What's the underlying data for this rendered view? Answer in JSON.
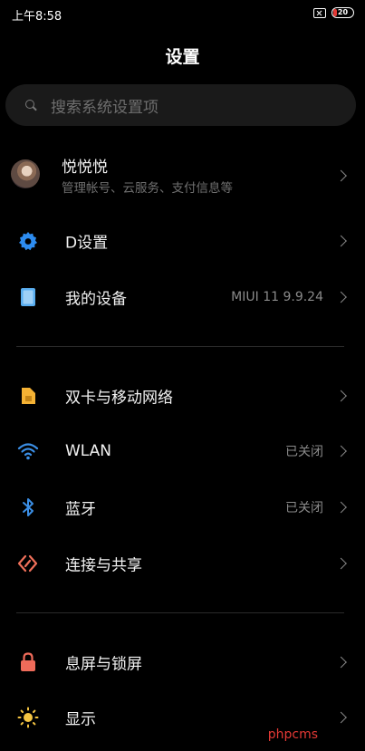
{
  "status_bar": {
    "time": "上午8:58",
    "battery": "20",
    "battery_level_percent": 20,
    "battery_color": "#e53935"
  },
  "page_title": "设置",
  "search": {
    "placeholder": "搜索系统设置项"
  },
  "account": {
    "name": "悦悦悦",
    "subtitle": "管理帐号、云服务、支付信息等"
  },
  "rows": [
    {
      "label": "D设置",
      "value": "",
      "icon": "gear-icon",
      "icon_color": "#2d8cf0"
    },
    {
      "label": "我的设备",
      "value": "MIUI 11 9.9.24",
      "icon": "phone-icon",
      "icon_color": "#5aaef0"
    },
    {
      "label": "双卡与移动网络",
      "value": "",
      "icon": "sim-card-icon",
      "icon_color": "#f5b234"
    },
    {
      "label": "WLAN",
      "value": "已关闭",
      "icon": "wifi-icon",
      "icon_color": "#3b8fe6"
    },
    {
      "label": "蓝牙",
      "value": "已关闭",
      "icon": "bluetooth-icon",
      "icon_color": "#3b8fe6"
    },
    {
      "label": "连接与共享",
      "value": "",
      "icon": "share-icon",
      "icon_color": "#f0705a"
    },
    {
      "label": "息屏与锁屏",
      "value": "",
      "icon": "lock-icon",
      "icon_color": "#ef6b5a"
    },
    {
      "label": "显示",
      "value": "",
      "icon": "sun-icon",
      "icon_color": "#f5c542"
    }
  ],
  "watermark": "phpcms"
}
